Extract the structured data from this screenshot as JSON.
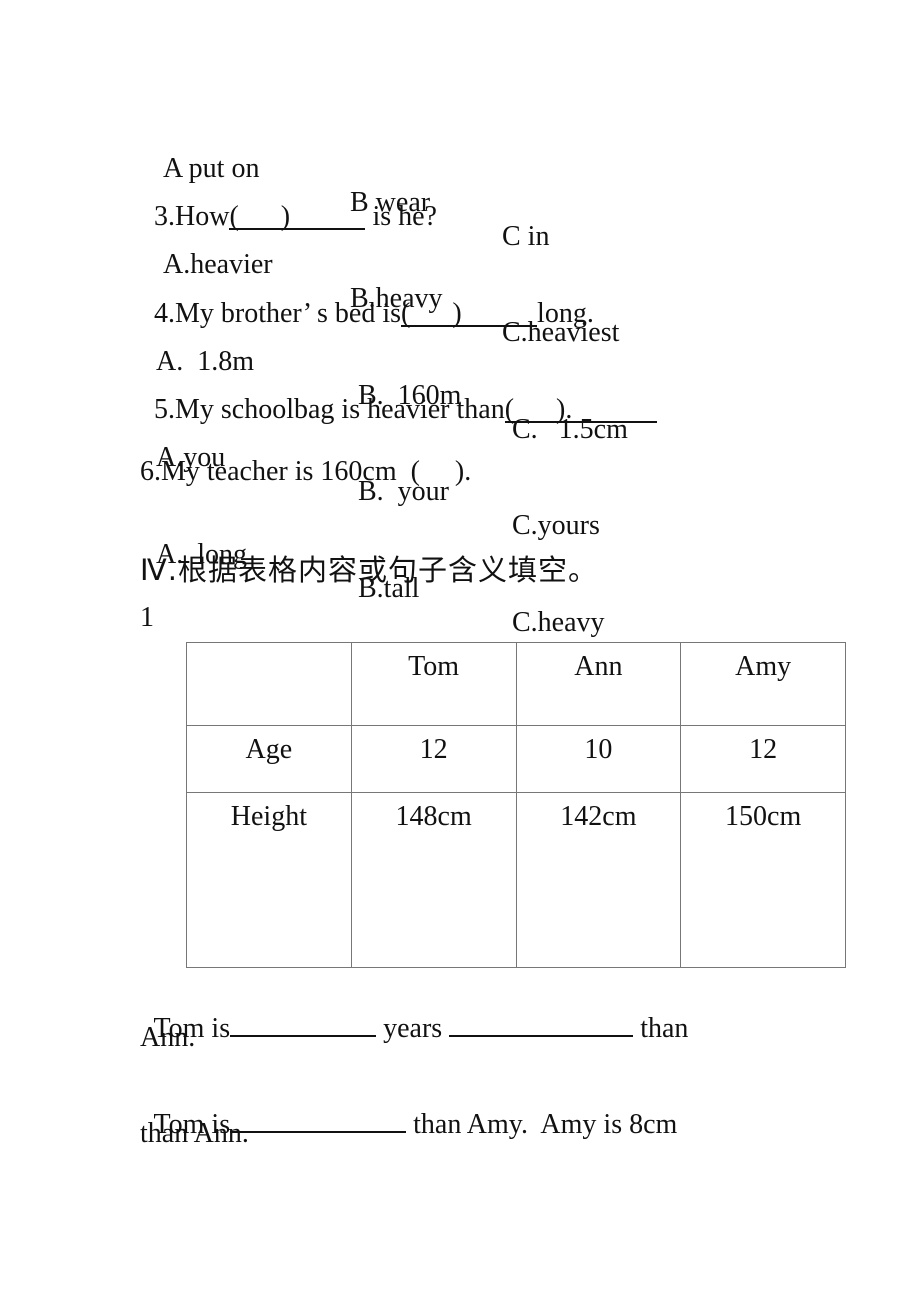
{
  "q2_options": {
    "a": "A put on",
    "b": "B wear",
    "c": "C in"
  },
  "q3": {
    "prefix": "3.How",
    "blank": "(      )",
    "suffix": " is he?",
    "options": {
      "a": "A.heavier",
      "b": "B.heavy",
      "c": "C.heaviest"
    }
  },
  "q4": {
    "prefix": "4.My brother’ s bed is",
    "blank": "(      )",
    "suffix": "long.",
    "options": {
      "a": "A.  1.8m",
      "b": "B.  160m",
      "c": "C.   1.5cm"
    }
  },
  "q5": {
    "prefix": "5.My schoolbag is heavier than",
    "blank": "(      ).",
    "options": {
      "a": "A.you",
      "b": "B.  your",
      "c": "C.yours"
    }
  },
  "q6": {
    "text": "6.My teacher is 160cm  (     ).",
    "options": {
      "a": "A.  long",
      "b": "B.tall",
      "c": "C.heavy"
    }
  },
  "section4": {
    "heading": "Ⅳ.根据表格内容或句子含义填空。",
    "item_number": "1"
  },
  "table": {
    "header": [
      "",
      "Tom",
      "Ann",
      "Amy"
    ],
    "rows": [
      [
        "Age",
        "12",
        "10",
        "12"
      ],
      [
        "Height",
        "148cm",
        "142cm",
        "150cm"
      ]
    ]
  },
  "fill": {
    "s1_a": "Tom is",
    "s1_b": " years ",
    "s1_c": " than",
    "s1_d": "Ann.",
    "s2_a": "Tom is",
    "s2_b": " than Amy.  Amy is 8cm",
    "s2_c": "than Ann."
  }
}
